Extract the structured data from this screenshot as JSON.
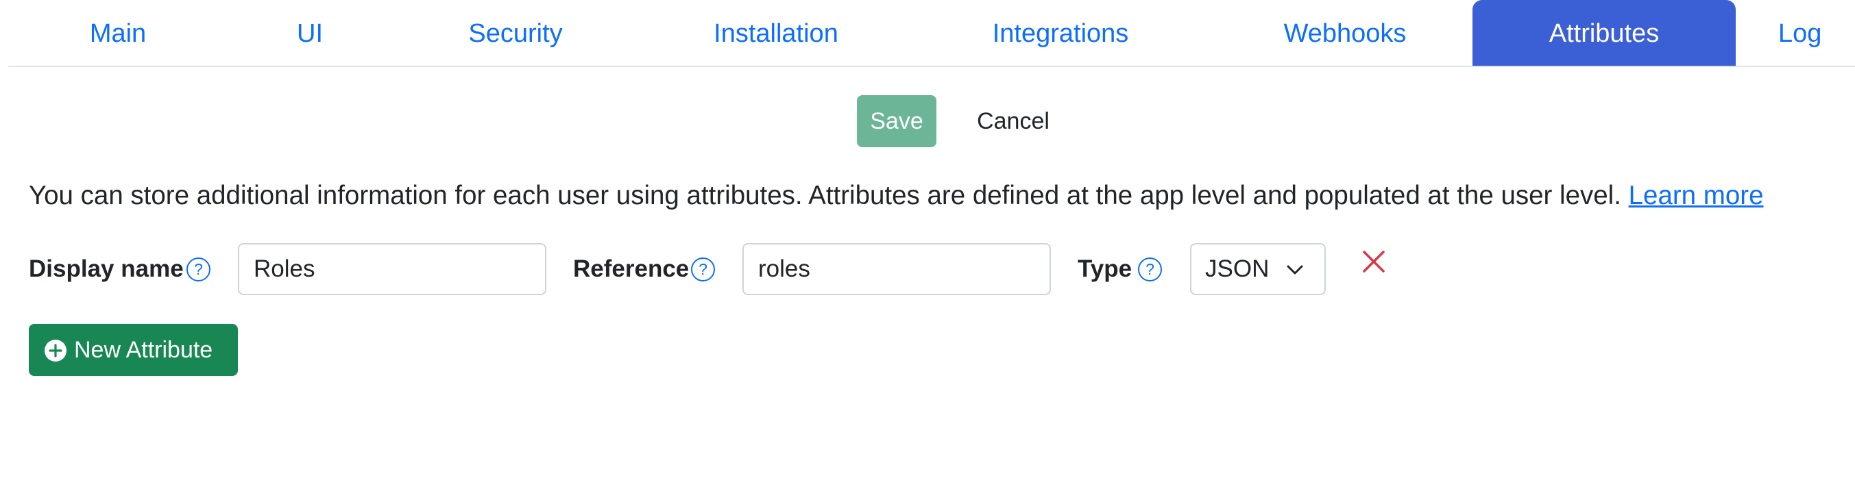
{
  "tabs": [
    {
      "label": "Main",
      "active": false
    },
    {
      "label": "UI",
      "active": false
    },
    {
      "label": "Security",
      "active": false
    },
    {
      "label": "Installation",
      "active": false
    },
    {
      "label": "Integrations",
      "active": false
    },
    {
      "label": "Webhooks",
      "active": false
    },
    {
      "label": "Attributes",
      "active": true
    },
    {
      "label": "Log",
      "active": false
    }
  ],
  "toolbar": {
    "save_label": "Save",
    "cancel_label": "Cancel"
  },
  "info": {
    "text": "You can store additional information for each user using attributes. Attributes are defined at the app level and populated at the user level.",
    "link": "Learn more"
  },
  "attribute": {
    "display_name_label": "Display name",
    "display_name_value": "Roles",
    "reference_label": "Reference",
    "reference_value": "roles",
    "type_label": "Type",
    "type_value": "JSON"
  },
  "help_glyph": "?",
  "new_attribute_label": "New Attribute",
  "colors": {
    "link": "#0d6efd",
    "active_tab": "#3b5fd4",
    "save_button": "#6cb596",
    "new_button": "#198754",
    "remove_icon": "#dc3545"
  },
  "icons": {
    "help": "question-circle-icon",
    "type_dropdown": "chevron-down-icon",
    "remove": "close-icon",
    "new": "plus-circle-icon"
  }
}
